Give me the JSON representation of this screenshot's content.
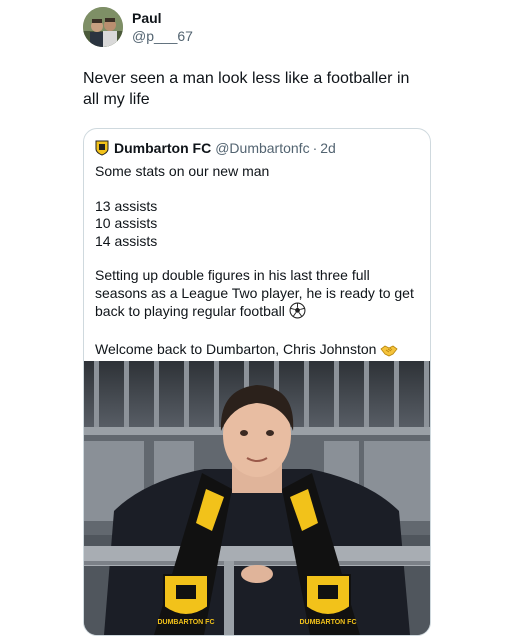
{
  "author": {
    "name": "Paul",
    "handle": "@p___67"
  },
  "tweet": {
    "text": "Never seen a man look less like a footballer in all my life"
  },
  "quote": {
    "name": "Dumbarton FC",
    "handle": "@Dumbartonfc",
    "separator": "·",
    "time": "2d",
    "line1": "Some stats on our new man",
    "assists": [
      "13 assists",
      "10 assists",
      "14 assists"
    ],
    "paragraph": "Setting up double figures in his last three full seasons as a League Two player, he is ready to get back to playing regular football",
    "welcome": "Welcome back to Dumbarton, Chris Johnston",
    "football_emoji": "football-icon",
    "handshake_emoji": "handshake-icon"
  },
  "photo": {
    "scarf_text_left": "DUMBARTON FC",
    "scarf_text_right": "DUMBARTON FC",
    "scarf_colors": {
      "black": "#111111",
      "gold": "#f2c21a"
    }
  },
  "colors": {
    "text": "#0f1419",
    "secondary": "#536471",
    "border": "#cfd9de"
  }
}
